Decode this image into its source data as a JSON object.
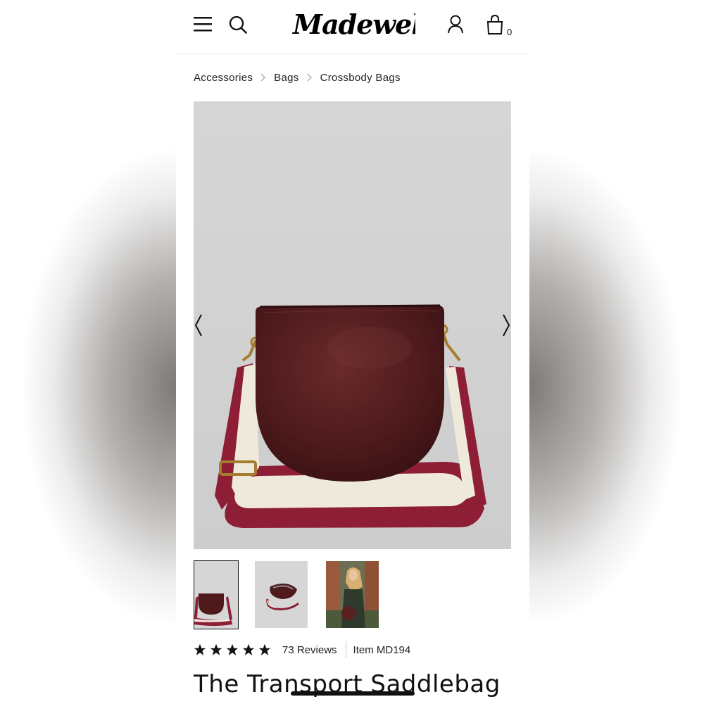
{
  "header": {
    "logo_text": "Madewell",
    "bag_count": "0",
    "icons": [
      "hamburger-menu-icon",
      "search-icon",
      "account-icon",
      "shopping-bag-icon"
    ]
  },
  "breadcrumb": {
    "items": [
      "Accessories",
      "Bags",
      "Crossbody Bags"
    ]
  },
  "gallery": {
    "thumbnails": 3,
    "selected_index": 0
  },
  "product": {
    "rating_stars": 5,
    "reviews_label": "73 Reviews",
    "item_label": "Item MD194",
    "title": "The Transport Saddlebag"
  },
  "colors": {
    "leather": "#4e1a1c",
    "strap_burgundy": "#8e1e36",
    "strap_cream": "#efe9dc",
    "image_background": "#d6d6d6"
  }
}
